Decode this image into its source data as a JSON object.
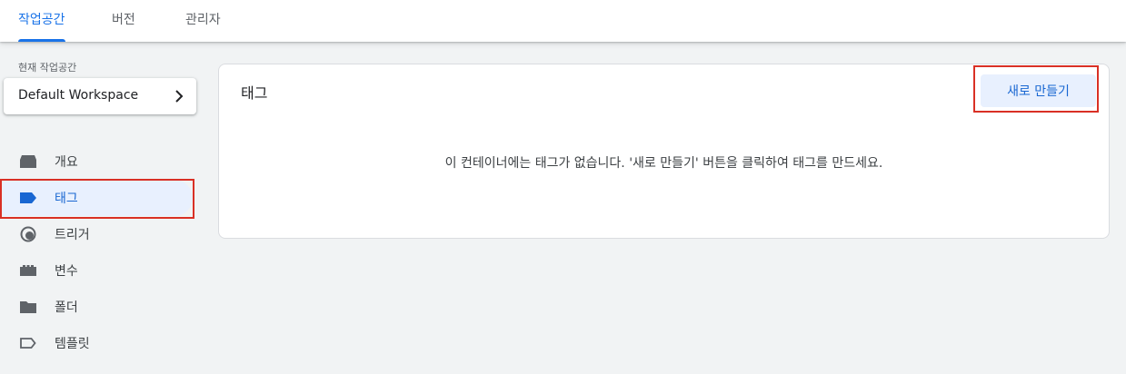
{
  "top_tabs": [
    {
      "label": "작업공간",
      "active": true
    },
    {
      "label": "버전",
      "active": false
    },
    {
      "label": "관리자",
      "active": false
    }
  ],
  "workspace": {
    "label": "현재 작업공간",
    "name": "Default Workspace"
  },
  "sidebar": {
    "items": [
      {
        "label": "개요",
        "icon": "overview-icon",
        "active": false
      },
      {
        "label": "태그",
        "icon": "tag-icon",
        "active": true
      },
      {
        "label": "트리거",
        "icon": "trigger-icon",
        "active": false
      },
      {
        "label": "변수",
        "icon": "variable-icon",
        "active": false
      },
      {
        "label": "폴더",
        "icon": "folder-icon",
        "active": false
      },
      {
        "label": "템플릿",
        "icon": "template-icon",
        "active": false
      }
    ]
  },
  "main": {
    "title": "태그",
    "new_button_label": "새로 만들기",
    "empty_message": "이 컨테이너에는 태그가 없습니다. '새로 만들기' 버튼을 클릭하여 태그를 만드세요."
  },
  "colors": {
    "accent": "#1a73e8",
    "active_bg": "#e8f0fe",
    "highlight": "#d93025",
    "icon": "#5f6368"
  }
}
